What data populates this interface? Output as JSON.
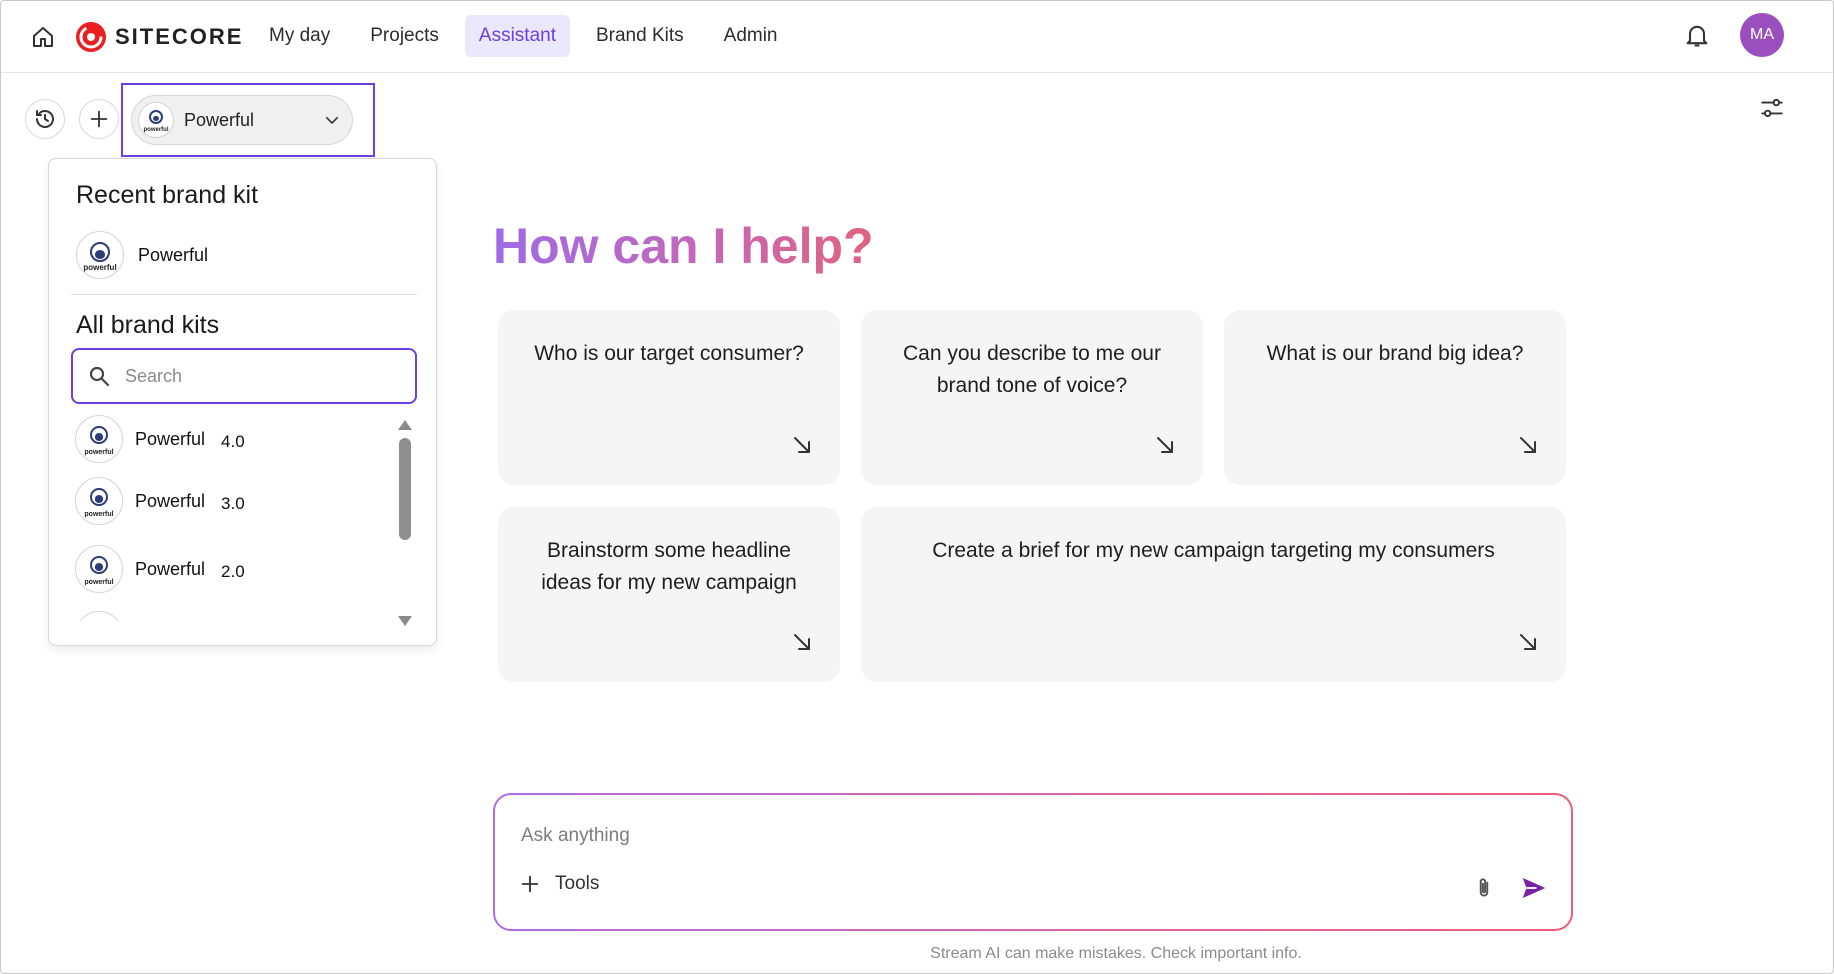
{
  "app": {
    "logo_text": "SITECORE"
  },
  "nav": {
    "items": [
      {
        "label": "My day"
      },
      {
        "label": "Projects"
      },
      {
        "label": "Assistant",
        "active": true
      },
      {
        "label": "Brand Kits"
      },
      {
        "label": "Admin"
      }
    ]
  },
  "user": {
    "initials": "MA",
    "avatar_color": "#9b4fbe"
  },
  "selector": {
    "selected_label": "Powerful",
    "logo_word": "powerful"
  },
  "dropdown": {
    "recent_title": "Recent brand kit",
    "recent_item": {
      "name": "Powerful",
      "logo_word": "powerful"
    },
    "all_title": "All brand kits",
    "search_placeholder": "Search",
    "kits": [
      {
        "name": "Powerful",
        "version": "4.0",
        "logo_word": "powerful"
      },
      {
        "name": "Powerful",
        "version": "3.0",
        "logo_word": "powerful"
      },
      {
        "name": "Powerful",
        "version": "2.0",
        "logo_word": "powerful"
      }
    ]
  },
  "main": {
    "headline": "How can I help?",
    "suggestions": [
      "Who is our target consumer?",
      "Can you describe to me our brand tone of voice?",
      "What is our brand big idea?",
      "Brainstorm some headline ideas for my new campaign",
      "Create a brief for my new campaign targeting my consumers"
    ]
  },
  "composer": {
    "placeholder": "Ask anything",
    "tools_label": "Tools"
  },
  "footer": {
    "disclaimer": "Stream AI can make mistakes. Check important info."
  },
  "colors": {
    "accent": "#6d3fe0",
    "active_nav_bg": "#ece8fb",
    "card_bg": "#f5f5f5",
    "brand_red": "#eb1f1f"
  },
  "icons": [
    "home-icon",
    "sitecore-logo-icon",
    "bell-icon",
    "history-icon",
    "plus-icon",
    "chevron-down-icon",
    "sliders-icon",
    "search-icon",
    "arrow-down-right-icon",
    "paperclip-icon",
    "send-icon"
  ]
}
